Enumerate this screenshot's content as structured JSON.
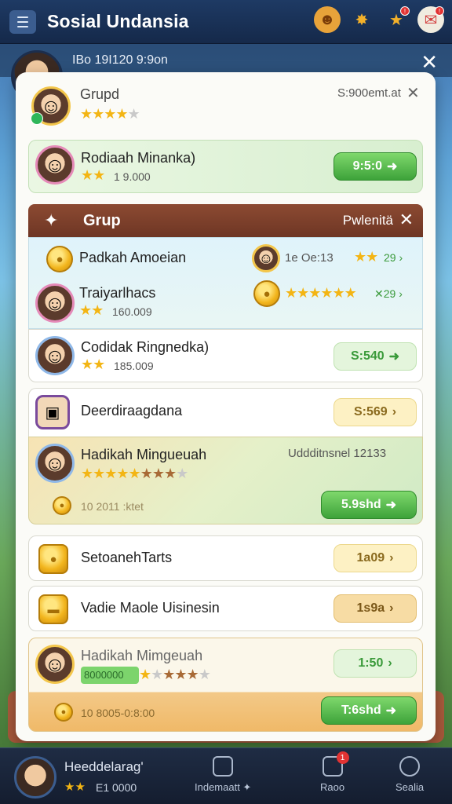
{
  "app": {
    "title": "Sosial Undansia"
  },
  "top_icons": [
    "face-icon",
    "trophy-icon",
    "star-badge-icon",
    "gift-badge-icon"
  ],
  "background": {
    "row_text": "IBo 19I120 9:9on"
  },
  "dialog": {
    "group_card": {
      "title": "Grupd",
      "right_text": "S:900emt.at",
      "stars": 4
    },
    "friend1": {
      "name": "Rodiaah Minanka)",
      "stars": 2,
      "score": "1 9.000",
      "button": "9:5:0"
    },
    "header": {
      "title": "Grup",
      "right_text": "Pwlenitä"
    },
    "leaderboard": [
      {
        "name": "Padkah Amoeian",
        "mid": "1e Oe:13",
        "stars": 2,
        "value": "29"
      },
      {
        "name": "Traiyarlhacs",
        "sub": "160.009",
        "stars": 6,
        "value": "29"
      }
    ],
    "friend2": {
      "name": "Codidak Ringnedka)",
      "stars": 2,
      "score": "185.009",
      "button": "S:540"
    },
    "item1": {
      "name": "Deerdiraagdana",
      "button": "S:569"
    },
    "featured": {
      "name": "Hadikah Mingueuah",
      "right_text": "Uddditnsnel 12133",
      "info": "10 2011 :ktet",
      "button": "5.9shd",
      "stars_gold": 5,
      "stars_bronze": 3,
      "stars_off": 1
    },
    "item2": {
      "name": "SetoanehTarts",
      "button": "1a09"
    },
    "item3": {
      "name": "Vadie Maole Uisinesin",
      "button": "1s9a"
    },
    "featured2": {
      "name": "Hadikah Mimgeuah",
      "progress_label": "8000000",
      "info": "10 8005-0:8:00",
      "button": "T:6shd",
      "button_top": "1:50"
    }
  },
  "bottom": {
    "user_name": "Heeddelarag'",
    "user_score": "E1 0000",
    "tabs": [
      {
        "label": "Indemaatt ✦",
        "badge": ""
      },
      {
        "label": "Raoo",
        "badge": "1"
      },
      {
        "label": "Sealia",
        "badge": ""
      }
    ]
  },
  "colors": {
    "accent_green": "#3da33a",
    "header_brown": "#7a3f2a",
    "topbar": "#1e3a64"
  }
}
